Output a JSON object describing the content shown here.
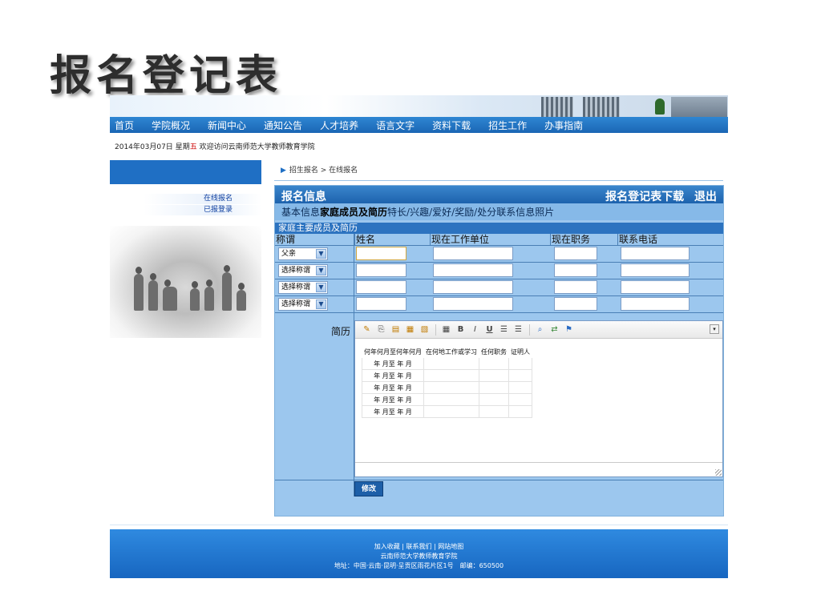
{
  "slide_title": "报名登记表",
  "nav": [
    "首页",
    "学院概况",
    "新闻中心",
    "通知公告",
    "人才培养",
    "语言文字",
    "资料下载",
    "招生工作",
    "办事指南"
  ],
  "datebar": {
    "date": "2014年03月07日",
    "week_label": "星期",
    "week_day": "五",
    "welcome": "欢迎访问云南师范大学教师教育学院"
  },
  "side_links": [
    "在线报名",
    "已报登录"
  ],
  "breadcrumb": {
    "arrow": "▶",
    "path": "招生报名 > 在线报名"
  },
  "panel": {
    "title": "报名信息",
    "download_link": "报名登记表下载",
    "logout_link": "退出",
    "tabs": [
      "基本信息",
      "家庭成员及简历",
      "特长/兴趣/爱好/奖励/处分",
      "联系信息",
      "照片"
    ],
    "section_title": "家庭主要成员及简历",
    "columns": [
      "称谓",
      "姓名",
      "现在工作单位",
      "现在职务",
      "联系电话"
    ],
    "relations": [
      "父亲",
      "选择称谓",
      "选择称谓",
      "选择称谓"
    ],
    "resume_label": "简历",
    "resume_table": {
      "headers": [
        "何年何月至何年何月",
        "在何地工作或学习",
        "任何职务",
        "证明人"
      ],
      "rows": [
        [
          "年 月至 年 月",
          "",
          "",
          ""
        ],
        [
          "年 月至 年 月",
          "",
          "",
          ""
        ],
        [
          "年 月至 年 月",
          "",
          "",
          ""
        ],
        [
          "年 月至 年 月",
          "",
          "",
          ""
        ],
        [
          "年 月至 年 月",
          "",
          "",
          ""
        ]
      ]
    },
    "toolbar_icons": [
      "brush-icon",
      "copy-icon",
      "paste-icon",
      "paste-text-icon",
      "paste-word-icon",
      "table-icon",
      "bold-icon",
      "italic-icon",
      "underline-icon",
      "ordered-list-icon",
      "unordered-list-icon",
      "find-icon",
      "replace-icon",
      "flag-icon"
    ],
    "toolbar_glyphs": {
      "bold": "B",
      "italic": "I",
      "underline": "U"
    },
    "submit_label": "修改"
  },
  "footer": {
    "links": [
      "加入收藏",
      "联系我们",
      "网站地图"
    ],
    "separator": "|",
    "org": "云南师范大学教师教育学院",
    "address": "地址：中国·云南·昆明·呈贡区雨花片区1号　邮编：650500"
  }
}
